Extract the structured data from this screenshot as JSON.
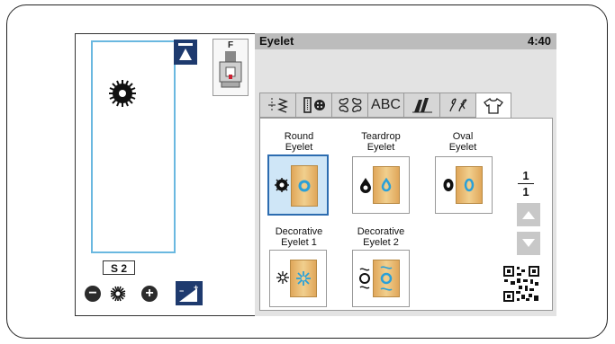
{
  "header": {
    "title": "Eyelet",
    "time": "4:40"
  },
  "presser_foot": {
    "label": "F"
  },
  "stitch": {
    "size": "S 2"
  },
  "tabs": [
    {
      "name": "utility-tab"
    },
    {
      "name": "buttonhole-tab"
    },
    {
      "name": "decorative-tab"
    },
    {
      "name": "alphabet-tab",
      "label": "ABC"
    },
    {
      "name": "satin-tab"
    },
    {
      "name": "floral-tab"
    },
    {
      "name": "shirt-tab",
      "active": true
    }
  ],
  "patterns": [
    {
      "label1": "Round",
      "label2": "Eyelet",
      "selected": true
    },
    {
      "label1": "Teardrop",
      "label2": "Eyelet"
    },
    {
      "label1": "Oval",
      "label2": "Eyelet"
    },
    {
      "label1": "Decorative",
      "label2": "Eyelet 1"
    },
    {
      "label1": "Decorative",
      "label2": "Eyelet 2"
    }
  ],
  "pagination": {
    "current": "1",
    "total": "1"
  }
}
